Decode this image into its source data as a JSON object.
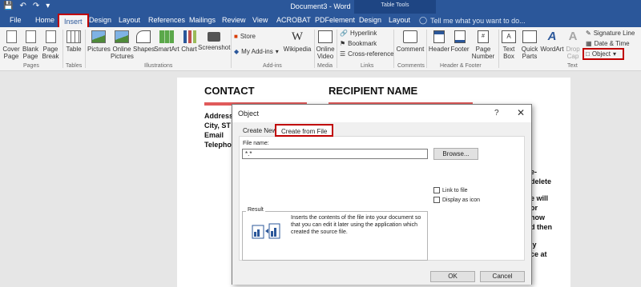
{
  "title_bar": {
    "document_title": "Document3 - Word",
    "context_label": "Table Tools",
    "qat_icons": [
      "save-icon",
      "undo-icon",
      "redo-icon"
    ]
  },
  "tabs": [
    {
      "label": "File"
    },
    {
      "label": "Home"
    },
    {
      "label": "Insert"
    },
    {
      "label": "Design"
    },
    {
      "label": "Layout"
    },
    {
      "label": "References"
    },
    {
      "label": "Mailings"
    },
    {
      "label": "Review"
    },
    {
      "label": "View"
    },
    {
      "label": "ACROBAT"
    },
    {
      "label": "PDFelement"
    },
    {
      "label": "Design"
    },
    {
      "label": "Layout"
    }
  ],
  "tell_me": "Tell me what you want to do...",
  "ribbon": {
    "pages": {
      "cover": "Cover\nPage",
      "blank": "Blank\nPage",
      "break": "Page\nBreak",
      "label": "Pages"
    },
    "tables": {
      "table": "Table",
      "label": "Tables"
    },
    "illustrations": {
      "pictures": "Pictures",
      "online": "Online\nPictures",
      "shapes": "Shapes",
      "smartart": "SmartArt",
      "chart": "Chart",
      "screenshot": "Screenshot",
      "label": "Illustrations"
    },
    "addins": {
      "store": "Store",
      "my": "My Add-ins",
      "wikipedia": "Wikipedia",
      "label": "Add-ins"
    },
    "media": {
      "video": "Online\nVideo",
      "label": "Media"
    },
    "links": {
      "hyperlink": "Hyperlink",
      "bookmark": "Bookmark",
      "crossref": "Cross-reference",
      "label": "Links"
    },
    "comments": {
      "comment": "Comment",
      "label": "Comments"
    },
    "header_footer": {
      "header": "Header",
      "footer": "Footer",
      "pagenum": "Page\nNumber",
      "label": "Header & Footer"
    },
    "text": {
      "textbox": "Text\nBox",
      "quick": "Quick\nParts",
      "wordart": "WordArt",
      "dropcap": "Drop\nCap",
      "label": "Text"
    },
    "symbols": {
      "signature": "Signature Line",
      "datetime": "Date & Time",
      "object": "Object"
    }
  },
  "document": {
    "contact_heading": "CONTACT",
    "recipient_heading": "RECIPIENT NAME",
    "address_lines": [
      "Address",
      "City, ST Z",
      "Email",
      "Telephon"
    ],
    "right_fragments": [
      "e-",
      "delete",
      "e will",
      "or",
      "how",
      "d then",
      "ly",
      "ce at"
    ],
    "accent_color": "#e05a5a"
  },
  "dialog": {
    "title": "Object",
    "help": "?",
    "close": "✕",
    "tab_create_new": "Create New",
    "tab_create_from_file": "Create from File",
    "file_name_label": "File name:",
    "file_name_value": "*.*",
    "browse_label": "Browse...",
    "link_to_file": "Link to file",
    "display_as_icon": "Display as icon",
    "result_label": "Result",
    "result_text": "Inserts the contents of the file into your document so that you can edit it later using the application which created the source file.",
    "ok_label": "OK",
    "cancel_label": "Cancel"
  }
}
